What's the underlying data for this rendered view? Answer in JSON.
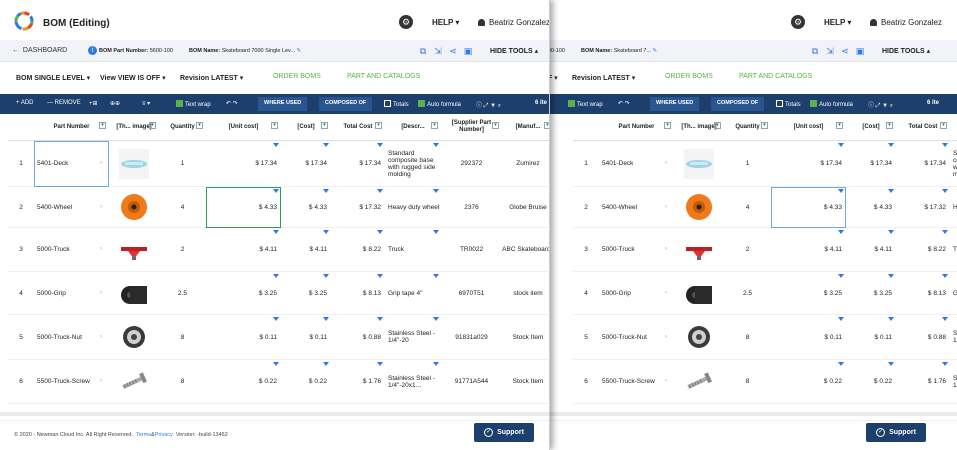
{
  "app": {
    "title": "BOM (Editing)"
  },
  "header": {
    "help": "HELP ▾",
    "user": "Beatriz Gonzalez"
  },
  "bar2": {
    "dashboard": "DASHBOARD",
    "part_number_label": "BOM Part Number:",
    "part_number": "5600-100",
    "bom_name_label": "BOM Name:",
    "bom_name_left": "Skateboard 7000 Single Lev...",
    "bom_name_right": "Skateboard 7...",
    "hide_tools": "HIDE TOOLS ▴"
  },
  "bar3": {
    "level": "BOM SINGLE LEVEL ▾",
    "view": "View VIEW IS OFF ▾",
    "revision": "Revision LATEST ▾",
    "order_boms": "ORDER BOMS",
    "parts_catalogs": "PART AND CATALOGS"
  },
  "toolbar": {
    "add": "+ ADD",
    "remove": "— REMOVE",
    "text_wrap": "Text wrap",
    "where_used": "WHERE USED",
    "composed_of": "COMPOSED OF",
    "totals": "Totals",
    "auto_formula": "Auto formula",
    "items": "6 ite"
  },
  "columns": {
    "part_number": "Part Number",
    "image": "[Th... image]",
    "quantity": "Quantity",
    "unit_cost": "[Unit cost]",
    "cost": "[Cost]",
    "total_cost": "Total Cost",
    "descr": "[Descr...",
    "supplier_pn": "[Supplier Part Number]",
    "manuf": "[Manuf..."
  },
  "rows": [
    {
      "n": "1",
      "part": "5401-Deck",
      "qty": "1",
      "unit": "$ 17.34",
      "cost": "$ 17.34",
      "total": "$ 17.34",
      "descr": "Standard composite base with rugged side molding",
      "supplier": "292372",
      "manuf": "Zumirez",
      "img": "deck"
    },
    {
      "n": "2",
      "part": "5400-Wheel",
      "qty": "4",
      "unit": "$ 4.33",
      "cost": "$ 4.33",
      "total": "$ 17.32",
      "descr": "Heavy duty wheel",
      "supplier": "2376",
      "manuf": "Globe Bruise",
      "img": "wheel"
    },
    {
      "n": "3",
      "part": "5000-Truck",
      "qty": "2",
      "unit": "$ 4.11",
      "cost": "$ 4.11",
      "total": "$ 8.22",
      "descr": "Truck",
      "supplier": "TR0022",
      "manuf": "ABC Skateboards",
      "img": "truck"
    },
    {
      "n": "4",
      "part": "5000-Grip",
      "qty": "2.5",
      "unit": "$ 3.25",
      "cost": "$ 3.25",
      "total": "$ 8.13",
      "descr": "Grip tape 4\"",
      "supplier": "6970T51",
      "manuf": "stock item",
      "img": "grip"
    },
    {
      "n": "5",
      "part": "5000-Truck-Nut",
      "qty": "8",
      "unit": "$ 0.11",
      "cost": "$ 0.11",
      "total": "$ 0.88",
      "descr": "Stainless Steel - 1/4\"-20",
      "supplier": "91831a029",
      "manuf": "Stock Item",
      "img": "nut"
    },
    {
      "n": "6",
      "part": "5500-Truck-Screw",
      "qty": "8",
      "unit": "$ 0.22",
      "cost": "$ 0.22",
      "total": "$ 1.76",
      "descr": "Stainless Steel - 1/4\"-20x1...",
      "supplier": "91771A544",
      "manuf": "Stock Item",
      "img": "screw"
    }
  ],
  "footer": {
    "copyright": "© 2020 - Newman Cloud Inc. All Right Reserved.",
    "copyright_right": "l Right Reserved.",
    "terms": "Terms",
    "amp": "&",
    "privacy": "Privacy",
    "version": "Version: -build-13462",
    "support": "Support"
  },
  "colors": {
    "navy": "#1d3f6e",
    "green": "#59b24a",
    "blue": "#2c7be5",
    "wheel": "#f07a1a"
  }
}
